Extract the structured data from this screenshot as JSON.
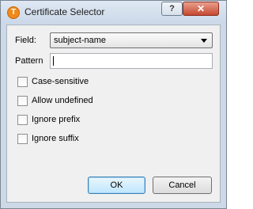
{
  "window": {
    "title": "Certificate Selector",
    "help_label": "?",
    "close_label": "✕"
  },
  "form": {
    "field_label": "Field:",
    "field_value": "subject-name",
    "pattern_label": "Pattern",
    "pattern_value": ""
  },
  "options": [
    {
      "label": "Case-sensitive",
      "checked": false
    },
    {
      "label": "Allow undefined",
      "checked": false
    },
    {
      "label": "Ignore prefix",
      "checked": false
    },
    {
      "label": "Ignore suffix",
      "checked": false
    }
  ],
  "buttons": {
    "ok_label": "OK",
    "cancel_label": "Cancel"
  },
  "icons": {
    "app_icon_letter": "T"
  }
}
